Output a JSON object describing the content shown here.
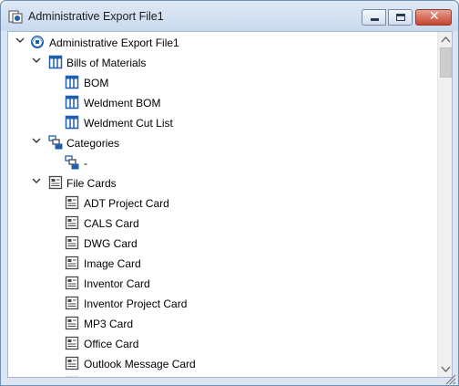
{
  "window": {
    "title": "Administrative Export File1"
  },
  "tree": {
    "root": {
      "label": "Administrative Export File1",
      "icon": "export-file-icon",
      "expanded": true
    },
    "groups": [
      {
        "label": "Bills of Materials",
        "icon": "table-icon",
        "expanded": true,
        "children": [
          "BOM",
          "Weldment BOM",
          "Weldment Cut List"
        ],
        "child_icon": "table-icon"
      },
      {
        "label": "Categories",
        "icon": "categories-icon",
        "expanded": true,
        "children": [
          "-"
        ],
        "child_icon": "categories-icon"
      },
      {
        "label": "File Cards",
        "icon": "card-icon",
        "expanded": true,
        "children": [
          "ADT Project Card",
          "CALS Card",
          "DWG Card",
          "Image Card",
          "Inventor Card",
          "Inventor Project Card",
          "MP3 Card",
          "Office Card",
          "Outlook Message Card"
        ],
        "child_icon": "card-icon"
      }
    ]
  },
  "colors": {
    "title_bar": "#c9d9ee",
    "close_button": "#c6452e",
    "icon_blue": "#1f5fae"
  }
}
